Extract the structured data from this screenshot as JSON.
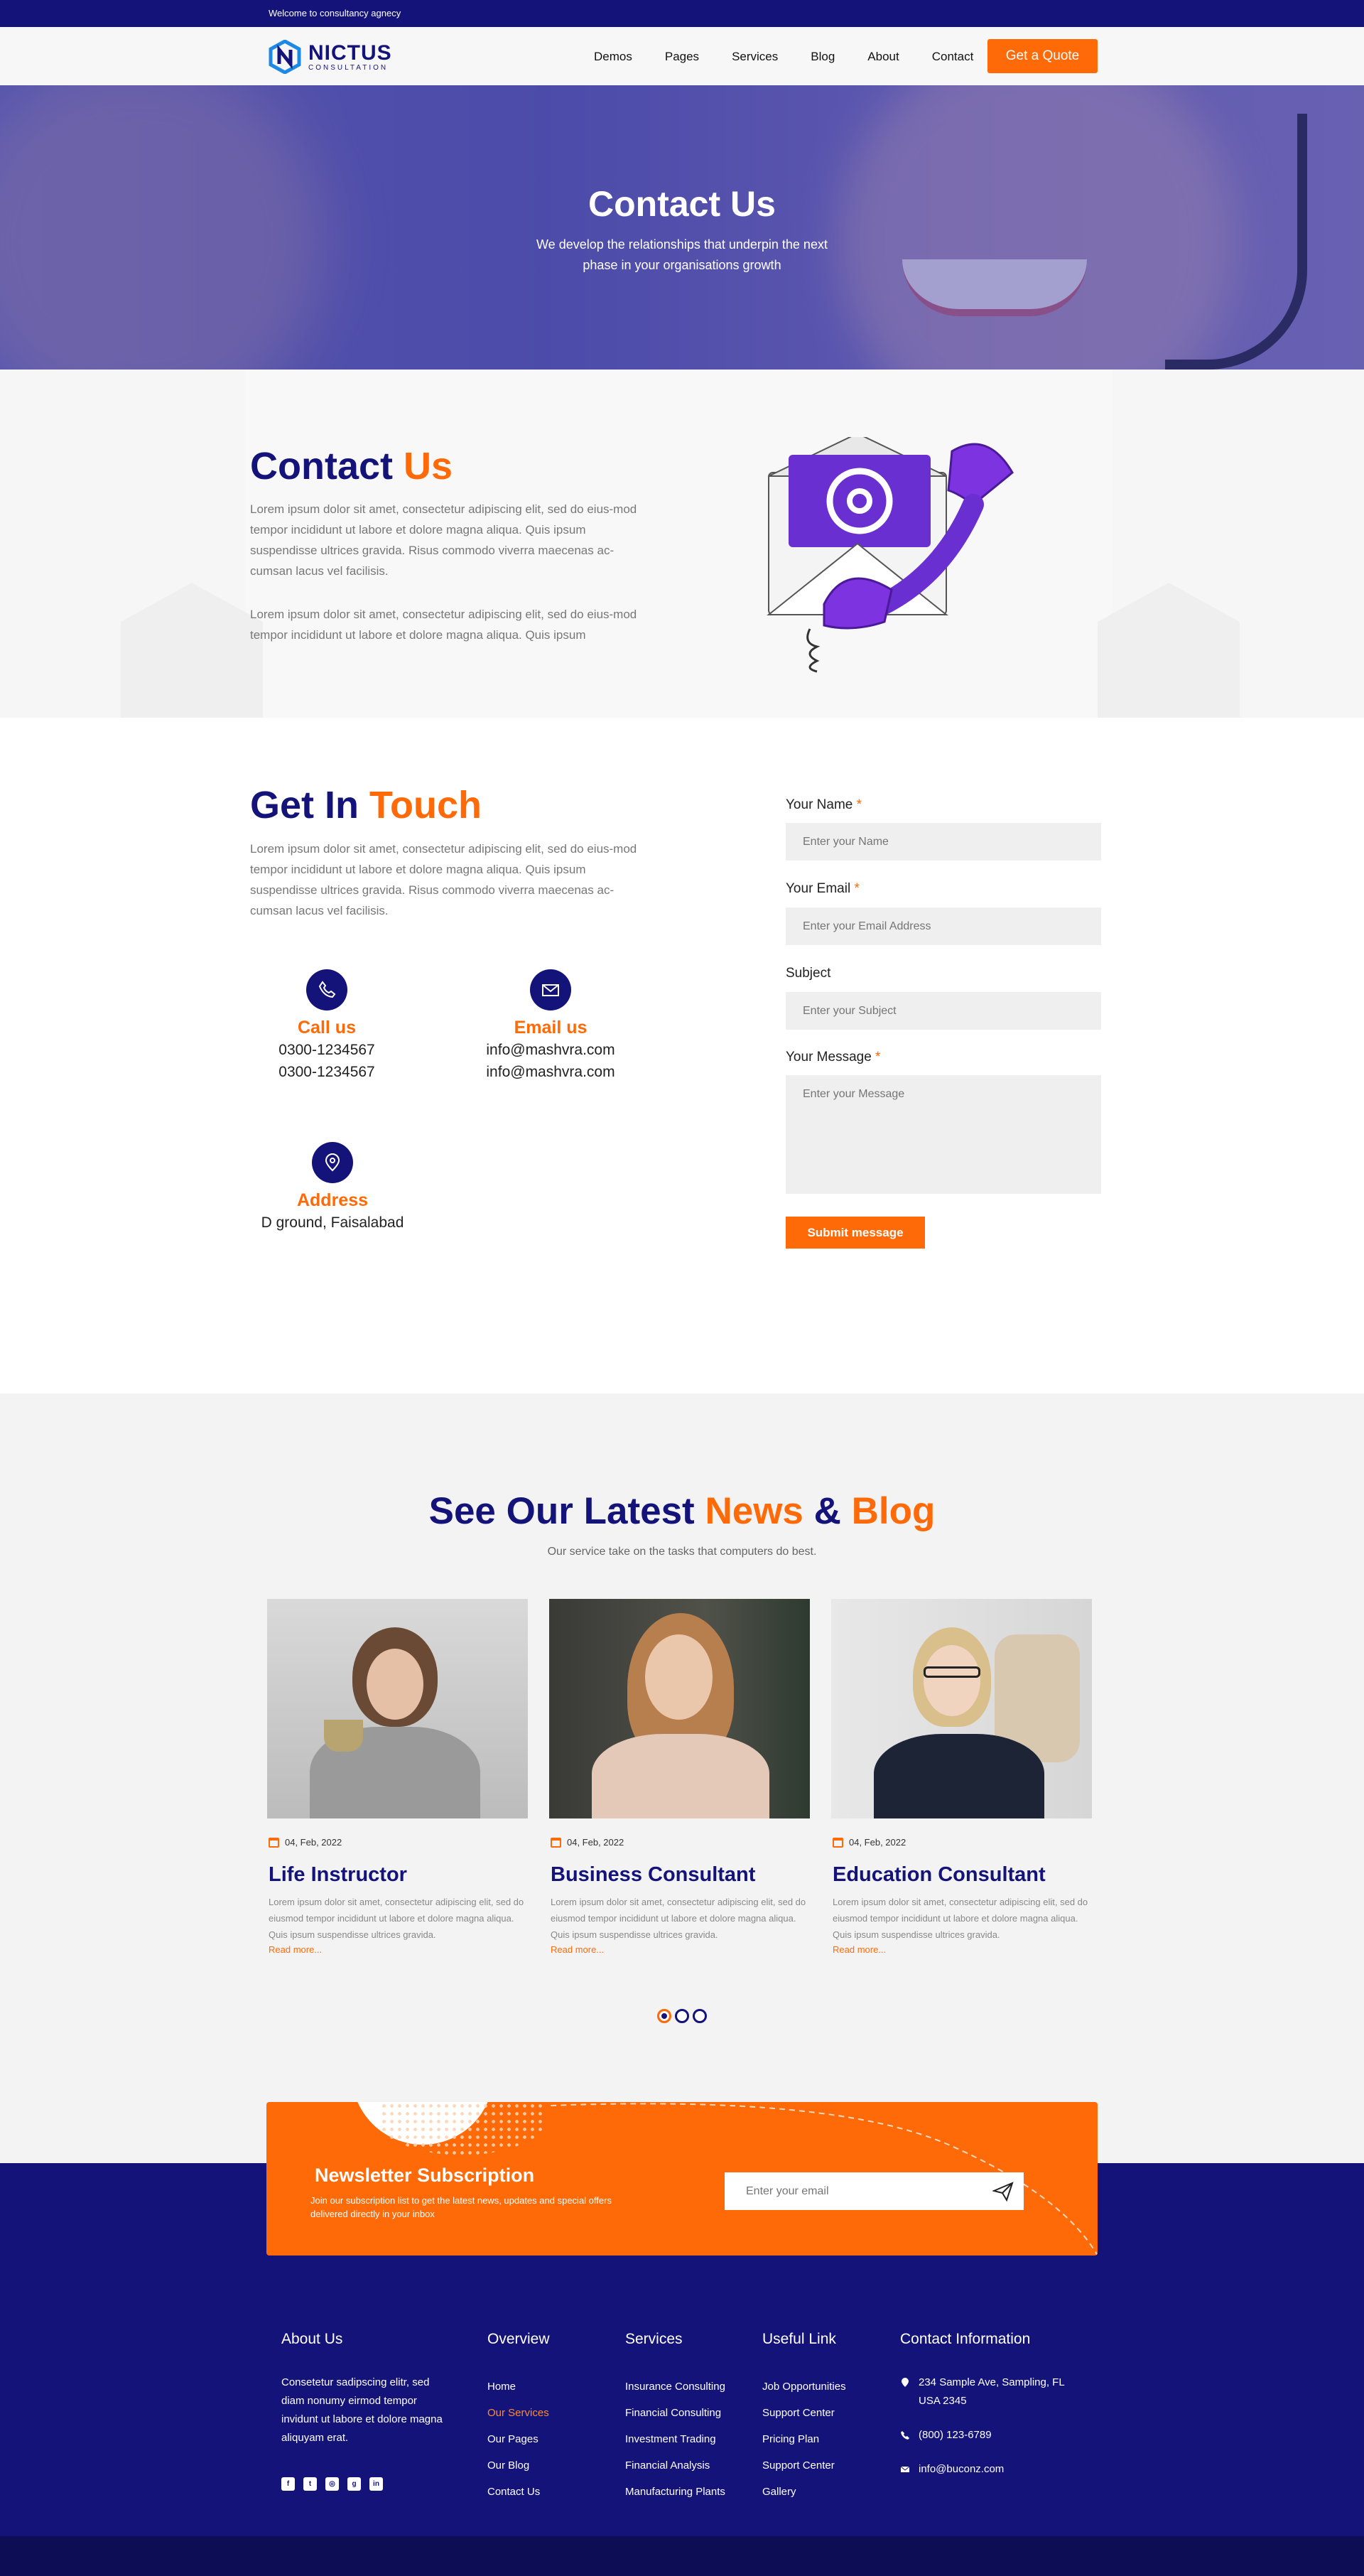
{
  "topbar": {
    "text": "Welcome to consultancy agnecy"
  },
  "header": {
    "logo_name": "NICTUS",
    "logo_sub": "CONSULTATION",
    "nav": [
      "Demos",
      "Pages",
      "Services",
      "Blog",
      "About",
      "Contact"
    ],
    "cta": "Get a Quote"
  },
  "hero": {
    "title": "Contact Us",
    "subtitle": "We develop the relationships that underpin the next phase in your organisations growth"
  },
  "about": {
    "title_a": "Contact",
    "title_b": "Us",
    "para1": "Lorem ipsum dolor sit amet, consectetur adipiscing elit, sed do eius-mod tempor incididunt ut labore et dolore magna aliqua. Quis ipsum suspendisse ultrices gravida. Risus commodo viverra maecenas ac-cumsan lacus vel facilisis.",
    "para2": "Lorem ipsum dolor sit amet, consectetur adipiscing elit, sed do eius-mod tempor incididunt ut labore et dolore magna aliqua. Quis ipsum",
    "illustration_icon": "email-phone-icon"
  },
  "touch": {
    "title_a": "Get In",
    "title_b": "Touch",
    "desc": "Lorem ipsum dolor sit amet, consectetur adipiscing elit, sed do eius-mod tempor incididunt ut labore et dolore magna aliqua. Quis ipsum suspendisse ultrices gravida. Risus commodo viverra maecenas ac-cumsan lacus vel facilisis.",
    "call": {
      "title": "Call us",
      "lines": [
        "0300-1234567",
        "0300-1234567"
      ],
      "icon": "phone-icon"
    },
    "email": {
      "title": "Email us",
      "lines": [
        "info@mashvra.com",
        "info@mashvra.com"
      ],
      "icon": "envelope-icon"
    },
    "address": {
      "title": "Address",
      "lines": [
        "D ground, Faisalabad"
      ],
      "icon": "location-pin-icon"
    }
  },
  "form": {
    "name_label": "Your Name",
    "name_placeholder": "Enter your Name",
    "email_label": "Your Email",
    "email_placeholder": "Enter your Email Address",
    "subject_label": "Subject",
    "subject_placeholder": "Enter your Subject",
    "message_label": "Your Message",
    "message_placeholder": "Enter your Message",
    "required_mark": "*",
    "submit": "Submit message"
  },
  "blog": {
    "title_a": "See Our Latest",
    "title_b": "News",
    "title_c": "&",
    "title_d": "Blog",
    "subtitle": "Our service take on the tasks that computers do best.",
    "cards": [
      {
        "date": "04, Feb, 2022",
        "title": "Life Instructor",
        "excerpt": "Lorem ipsum dolor sit amet, consectetur adipiscing elit, sed do eiusmod tempor incididunt ut labore et dolore magna aliqua. Quis ipsum suspendisse ultrices gravida.",
        "more": "Read more..."
      },
      {
        "date": "04, Feb, 2022",
        "title": "Business Consultant",
        "excerpt": "Lorem ipsum dolor sit amet, consectetur adipiscing elit, sed do eiusmod tempor incididunt ut labore et dolore magna aliqua. Quis ipsum suspendisse ultrices gravida.",
        "more": "Read more..."
      },
      {
        "date": "04, Feb, 2022",
        "title": "Education Consultant",
        "excerpt": "Lorem ipsum dolor sit amet, consectetur adipiscing elit, sed do eiusmod tempor incididunt ut labore et dolore magna aliqua. Quis ipsum suspendisse ultrices gravida.",
        "more": "Read more..."
      }
    ],
    "slider_dots": 3,
    "active_dot": 1
  },
  "newsletter": {
    "title": "Newsletter Subscription",
    "text": "Join our subscription list to get the latest news, updates and special offers delivered directly in your inbox",
    "placeholder": "Enter your email",
    "send_icon": "paper-plane-icon"
  },
  "footer": {
    "about_title": "About Us",
    "about_text": "Consetetur sadipscing elitr, sed diam nonumy eirmod tempor invidunt ut labore et dolore magna aliquyam erat.",
    "social_icons": [
      "facebook-icon",
      "twitter-icon",
      "instagram-icon",
      "google-icon",
      "linkedin-icon"
    ],
    "overview_title": "Overview",
    "overview": [
      "Home",
      "Our Services",
      "Our Pages",
      "Our Blog",
      "Contact Us"
    ],
    "overview_active": "Our Services",
    "services_title": "Services",
    "services": [
      "Insurance Consulting",
      "Financial Consulting",
      "Investment Trading",
      "Financial Analysis",
      "Manufacturing Plants"
    ],
    "useful_title": "Useful Link",
    "useful": [
      "Job Opportunities",
      "Support Center",
      "Pricing Plan",
      "Support Center",
      "Gallery"
    ],
    "contact_title": "Contact Information",
    "address": "234 Sample Ave, Sampling, FL USA 2345",
    "phone": "(800) 123-6789",
    "email": "info@buconz.com"
  },
  "colors": {
    "navy": "#13137a",
    "orange": "#ff6a08",
    "light_bg": "#f3f3f3"
  }
}
